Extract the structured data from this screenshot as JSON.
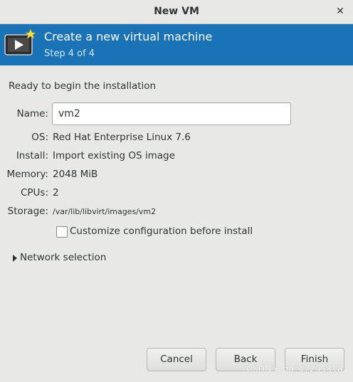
{
  "window": {
    "title": "New VM",
    "close_icon": "close-icon"
  },
  "header": {
    "title": "Create a new virtual machine",
    "step": "Step 4 of 4",
    "icon": "vm-monitor-icon",
    "accent_color": "#1a72b7"
  },
  "summary": {
    "ready_text": "Ready to begin the installation",
    "name_label": "Name:",
    "name_value": "vm2",
    "os_label": "OS:",
    "os_value": "Red Hat Enterprise Linux 7.6",
    "install_label": "Install:",
    "install_value": "Import existing OS image",
    "memory_label": "Memory:",
    "memory_value": "2048 MiB",
    "cpus_label": "CPUs:",
    "cpus_value": "2",
    "storage_label": "Storage:",
    "storage_value": "/var/lib/libvirt/images/vm2"
  },
  "customize": {
    "label": "Customize configuration before install",
    "checked": false
  },
  "network": {
    "label": "Network selection",
    "expanded": false
  },
  "buttons": {
    "cancel": "Cancel",
    "back": "Back",
    "finish": "Finish"
  },
  "watermark": "CSDN @qq_47295318"
}
